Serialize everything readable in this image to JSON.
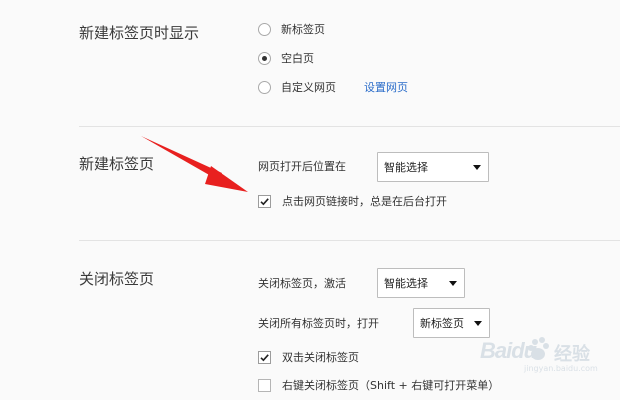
{
  "sections": {
    "new_tab_display": {
      "title": "新建标签页时显示",
      "options": [
        "新标签页",
        "空白页",
        "自定义网页"
      ],
      "selected_option": "空白页",
      "custom_link": "设置网页"
    },
    "new_tab": {
      "title": "新建标签页",
      "position_label": "网页打开后位置在",
      "position_select": "智能选择",
      "background_open_label": "点击网页链接时，总是在后台打开",
      "background_open_checked": true
    },
    "close_tab": {
      "title": "关闭标签页",
      "activate_label": "关闭标签页，激活",
      "activate_select": "智能选择",
      "close_all_label": "关闭所有标签页时，打开",
      "close_all_select": "新标签页",
      "double_click_label": "双击关闭标签页",
      "double_click_checked": true,
      "right_click_label": "右键关闭标签页（Shift + 右键可打开菜单）",
      "right_click_checked": false
    }
  },
  "watermark": {
    "text": "Baidu",
    "text2": "经验",
    "url": "jingyan.baidu.com"
  },
  "colors": {
    "arrow": "#e8201f",
    "link": "#2a6cc9"
  }
}
